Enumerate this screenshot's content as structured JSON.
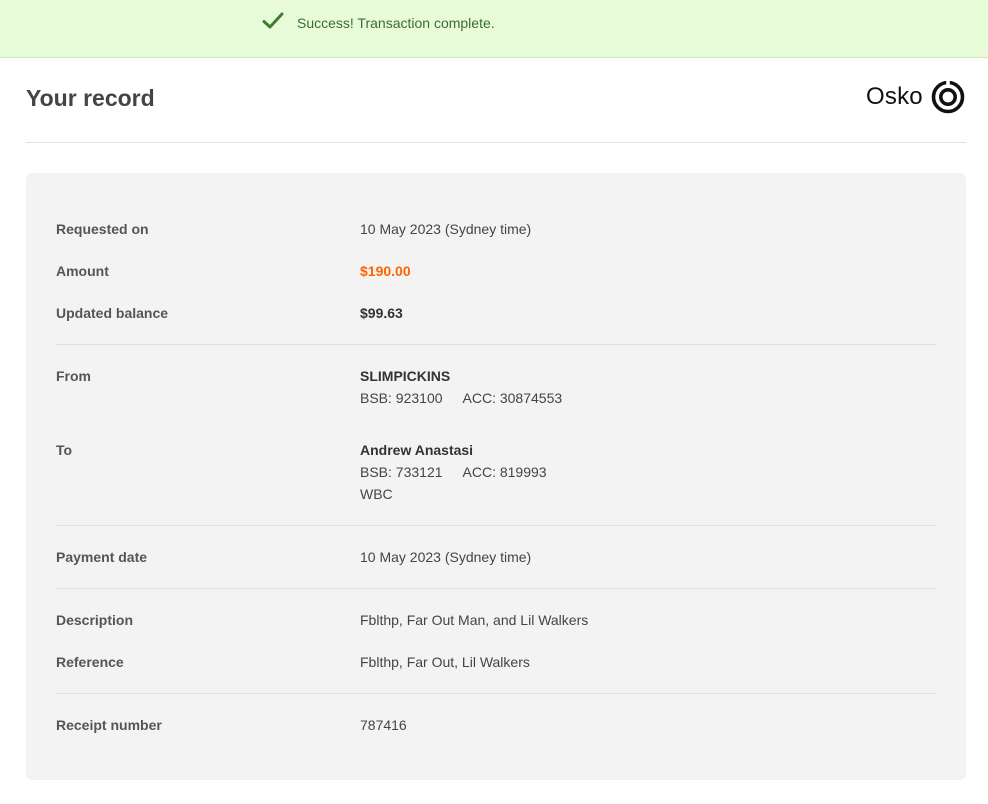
{
  "banner": {
    "message": "Success! Transaction complete.",
    "icon": "checkmark-icon",
    "color": "#3e6b34",
    "background": "#e8fbd9"
  },
  "header": {
    "title": "Your record",
    "brand": "Osko",
    "brand_icon": "osko-ring-icon"
  },
  "record": {
    "requested_on": {
      "label": "Requested on",
      "value": "10 May 2023 (Sydney time)"
    },
    "amount": {
      "label": "Amount",
      "value": "$190.00",
      "color": "#ff6200"
    },
    "updated_balance": {
      "label": "Updated balance",
      "value": "$99.63"
    },
    "from": {
      "label": "From",
      "name": "SLIMPICKINS",
      "bsb": "BSB: 923100",
      "acc": "ACC: 30874553"
    },
    "to": {
      "label": "To",
      "name": "Andrew Anastasi",
      "bsb": "BSB: 733121",
      "acc": "ACC: 819993",
      "bank": "WBC"
    },
    "payment_date": {
      "label": "Payment date",
      "value": "10 May 2023 (Sydney time)"
    },
    "description": {
      "label": "Description",
      "value": "Fblthp, Far Out Man, and Lil Walkers"
    },
    "reference": {
      "label": "Reference",
      "value": "Fblthp, Far Out, Lil Walkers"
    },
    "receipt_number": {
      "label": "Receipt number",
      "value": "787416"
    }
  }
}
